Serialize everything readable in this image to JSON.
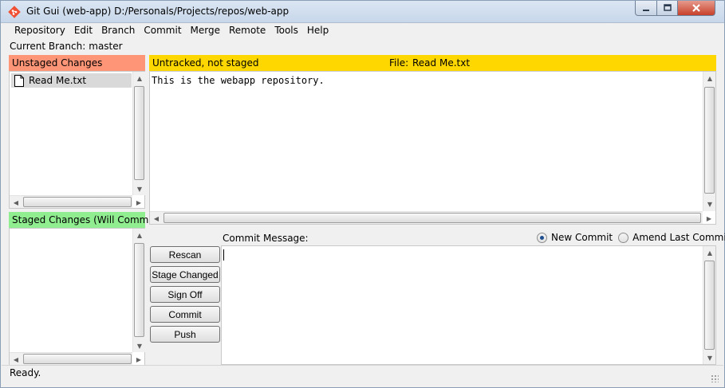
{
  "window": {
    "title": "Git Gui (web-app) D:/Personals/Projects/repos/web-app",
    "accent": "#f05033"
  },
  "menu": [
    "Repository",
    "Edit",
    "Branch",
    "Commit",
    "Merge",
    "Remote",
    "Tools",
    "Help"
  ],
  "branch": {
    "label": "Current Branch:",
    "name": "master"
  },
  "unstaged": {
    "header": "Unstaged Changes",
    "color": "#ff9577",
    "files": [
      "Read Me.txt"
    ]
  },
  "staged": {
    "header": "Staged Changes (Will Commit)",
    "color": "#90ee90",
    "files": []
  },
  "diff": {
    "status": "Untracked, not staged",
    "file_label": "File:",
    "file_name": "Read Me.txt",
    "color": "#ffd700",
    "content": "This is the webapp repository."
  },
  "commit": {
    "message_label": "Commit Message:",
    "message_value": "",
    "options": [
      {
        "label": "New Commit",
        "selected": true
      },
      {
        "label": "Amend Last Commit",
        "selected": false
      }
    ],
    "buttons": [
      "Rescan",
      "Stage Changed",
      "Sign Off",
      "Commit",
      "Push"
    ]
  },
  "status": "Ready."
}
